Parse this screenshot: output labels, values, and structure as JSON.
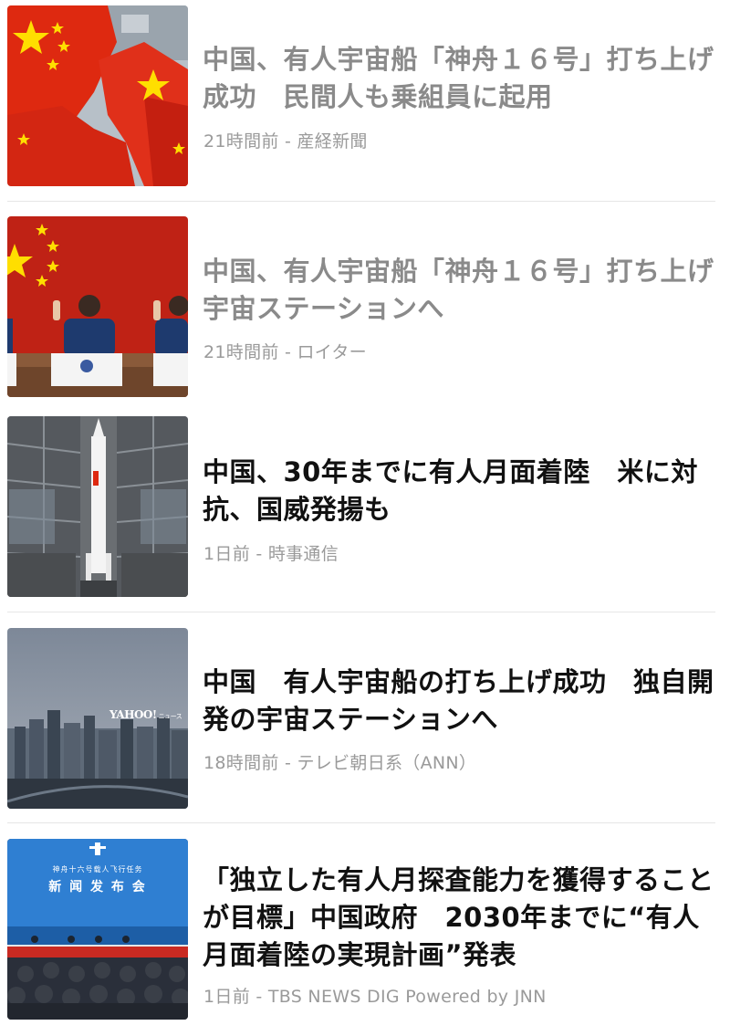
{
  "articles": [
    {
      "title": "中国、有人宇宙船「神舟１６号」打ち上げ成功　民間人も乗組員に起用",
      "time": "21時間前",
      "source": "産経新聞",
      "meta": "21時間前 - 産経新聞",
      "read": true,
      "thumb": "chinese-flags"
    },
    {
      "title": "中国、有人宇宙船「神舟１６号」打ち上げ　宇宙ステーションへ",
      "time": "21時間前",
      "source": "ロイター",
      "meta": "21時間前 - ロイター",
      "read": true,
      "thumb": "astronauts-press-conference"
    },
    {
      "title": "中国、30年までに有人月面着陸　米に対抗、国威発揚も",
      "time": "1日前",
      "source": "時事通信",
      "meta": "1日前 - 時事通信",
      "read": false,
      "thumb": "rocket-launch-tower"
    },
    {
      "title": "中国　有人宇宙船の打ち上げ成功　独自開発の宇宙ステーションへ",
      "time": "18時間前",
      "source": "テレビ朝日系（ANN）",
      "meta": "18時間前 - テレビ朝日系（ANN）",
      "read": false,
      "thumb": "city-skyline",
      "watermark": "YAHOO!",
      "watermark_sub": "ニュース"
    },
    {
      "title": "「独立した有人月探査能力を獲得することが目標」中国政府　2030年までに“有人月面着陸の実現計画”発表",
      "time": "1日前",
      "source": "TBS NEWS DIG Powered by JNN",
      "meta": "1日前 - TBS NEWS DIG Powered by JNN",
      "read": false,
      "thumb": "press-conference-hall",
      "screen_text_1": "神舟十六号载人飞行任务",
      "screen_text_2": "新 闻 发 布 会"
    }
  ],
  "colors": {
    "read_title": "#8a8a8a",
    "unread_title": "#111111",
    "meta": "#9a9a9a",
    "divider": "#e6e6e6",
    "flag_red": "#de2910",
    "flag_star": "#ffde00"
  }
}
